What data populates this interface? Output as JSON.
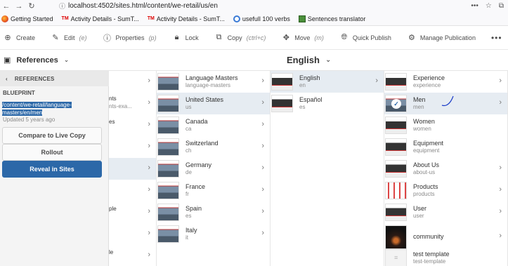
{
  "browser": {
    "url": "localhost:4502/sites.html/content/we-retail/us/en",
    "bookmarks": [
      {
        "label": "Getting Started",
        "icon": "firefox-icon"
      },
      {
        "label": "Activity Details - SumT...",
        "icon": "tm-icon"
      },
      {
        "label": "Activity Details - SumT...",
        "icon": "tm-icon"
      },
      {
        "label": "usefull 100 verbs",
        "icon": "globe-icon"
      },
      {
        "label": "Sentences translator",
        "icon": "translator-icon"
      }
    ],
    "tm_text": "TM"
  },
  "toolbar": {
    "create": "Create",
    "edit": "Edit",
    "edit_hint": "(e)",
    "properties": "Properties",
    "properties_hint": "(p)",
    "lock": "Lock",
    "copy": "Copy",
    "copy_hint": "(ctrl+c)",
    "move": "Move",
    "move_hint": "(m)",
    "quick_publish": "Quick Publish",
    "manage_publication": "Manage Publication",
    "more": "•••"
  },
  "rail": {
    "selector_label": "References",
    "locale_title": "English"
  },
  "references_panel": {
    "header": "REFERENCES",
    "blueprint_label": "BLUEPRINT",
    "blueprint_path": "/content/we-retail/language-masters/en/men",
    "updated": "Updated 5 years ago",
    "compare_button": "Compare to Live Copy",
    "rollout_button": "Rollout",
    "reveal_button": "Reveal in Sites"
  },
  "column1_fragments": [
    "nts",
    "nts-exa...",
    "es",
    "ple",
    "le"
  ],
  "column2": [
    {
      "title": "Language Masters",
      "name": "language-masters"
    },
    {
      "title": "United States",
      "name": "us"
    },
    {
      "title": "Canada",
      "name": "ca"
    },
    {
      "title": "Switzerland",
      "name": "ch"
    },
    {
      "title": "Germany",
      "name": "de"
    },
    {
      "title": "France",
      "name": "fr"
    },
    {
      "title": "Spain",
      "name": "es"
    },
    {
      "title": "Italy",
      "name": "it"
    }
  ],
  "column3": [
    {
      "title": "English",
      "name": "en"
    },
    {
      "title": "Español",
      "name": "es"
    }
  ],
  "column4": [
    {
      "title": "Experience",
      "name": "experience"
    },
    {
      "title": "Men",
      "name": "men"
    },
    {
      "title": "Women",
      "name": "women"
    },
    {
      "title": "Equipment",
      "name": "equipment"
    },
    {
      "title": "About Us",
      "name": "about-us"
    },
    {
      "title": "Products",
      "name": "products"
    },
    {
      "title": "User",
      "name": "user"
    },
    {
      "title": "community",
      "name": ""
    },
    {
      "title": "test template",
      "name": "test-template"
    }
  ],
  "colors": {
    "accent": "#2c68a8",
    "selected_row": "#e6ecf2",
    "panel_bg": "#f4f4f4"
  }
}
